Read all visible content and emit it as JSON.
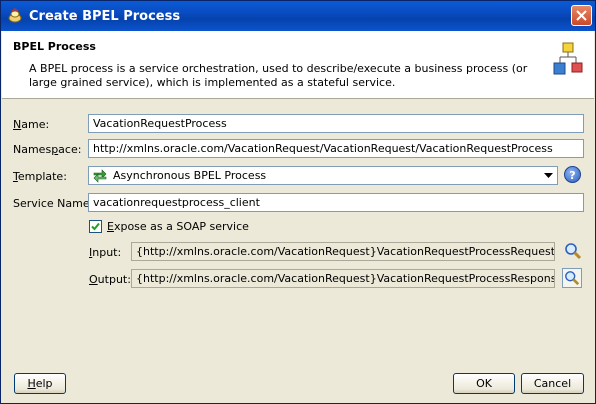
{
  "window": {
    "title": "Create BPEL Process"
  },
  "header": {
    "title": "BPEL Process",
    "description": "A BPEL process is a service orchestration, used to describe/execute a business process (or large grained service), which is implemented as a stateful service."
  },
  "form": {
    "name": {
      "label_key": "N",
      "label_rest": "ame:",
      "value": "VacationRequestProcess"
    },
    "namespace": {
      "label_pre": "Names",
      "label_key": "p",
      "label_rest": "ace:",
      "value": "http://xmlns.oracle.com/VacationRequest/VacationRequest/VacationRequestProcess"
    },
    "template": {
      "label_key": "T",
      "label_rest": "emplate:",
      "value": "Asynchronous BPEL Process",
      "icon": "bpel-template-icon"
    },
    "service_name": {
      "label": "Service Name:",
      "value": "vacationrequestprocess_client"
    },
    "expose_soap": {
      "label_key": "E",
      "label_rest": "xpose as a SOAP service",
      "checked": true
    },
    "input": {
      "label_key": "I",
      "label_rest": "nput:",
      "value": "{http://xmlns.oracle.com/VacationRequest}VacationRequestProcessRequest"
    },
    "output": {
      "label_key": "O",
      "label_rest": "utput:",
      "value": "{http://xmlns.oracle.com/VacationRequest}VacationRequestProcessResponse"
    }
  },
  "buttons": {
    "help_key": "H",
    "help_rest": "elp",
    "ok": "OK",
    "cancel": "Cancel"
  },
  "help_glyph": "?"
}
